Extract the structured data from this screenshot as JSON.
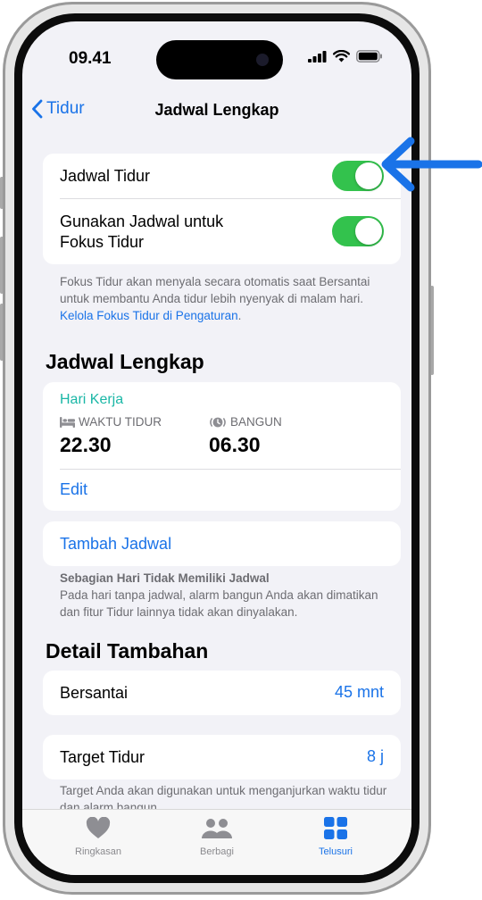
{
  "status": {
    "time": "09.41"
  },
  "nav": {
    "back_label": "Tidur",
    "title": "Jadwal Lengkap"
  },
  "sleep_schedule": {
    "toggles": [
      {
        "label": "Jadwal Tidur",
        "on": true
      },
      {
        "label_line1": "Gunakan Jadwal untuk",
        "label_line2": "Fokus Tidur",
        "on": true
      }
    ],
    "footnote": "Fokus Tidur akan menyala secara otomatis saat Bersantai untuk membantu Anda tidur lebih nyenyak di malam hari. ",
    "footnote_link": "Kelola Fokus Tidur di Pengaturan",
    "footnote_end": "."
  },
  "full_schedule": {
    "section_title": "Jadwal Lengkap",
    "day_label": "Hari Kerja",
    "bedtime_label": "WAKTU TIDUR",
    "bedtime_value": "22.30",
    "wake_label": "BANGUN",
    "wake_value": "06.30",
    "edit_label": "Edit",
    "add_label": "Tambah Jadwal",
    "note_title": "Sebagian Hari Tidak Memiliki Jadwal",
    "note_body": "Pada hari tanpa jadwal, alarm bangun Anda akan dimatikan dan fitur Tidur lainnya tidak akan dinyalakan."
  },
  "details": {
    "section_title": "Detail Tambahan",
    "wind_down_label": "Bersantai",
    "wind_down_value": "45 mnt",
    "sleep_goal_label": "Target Tidur",
    "sleep_goal_value": "8 j",
    "goal_note": "Target Anda akan digunakan untuk menganjurkan waktu tidur dan alarm bangun."
  },
  "tabs": [
    {
      "label": "Ringkasan",
      "icon": "heart-icon",
      "active": false
    },
    {
      "label": "Berbagi",
      "icon": "people-icon",
      "active": false
    },
    {
      "label": "Telusuri",
      "icon": "grid-icon",
      "active": true
    }
  ],
  "colors": {
    "accent": "#1a73e8",
    "toggle_on": "#33c24d",
    "teal": "#1ab7a6",
    "arrow": "#1a73e8"
  }
}
